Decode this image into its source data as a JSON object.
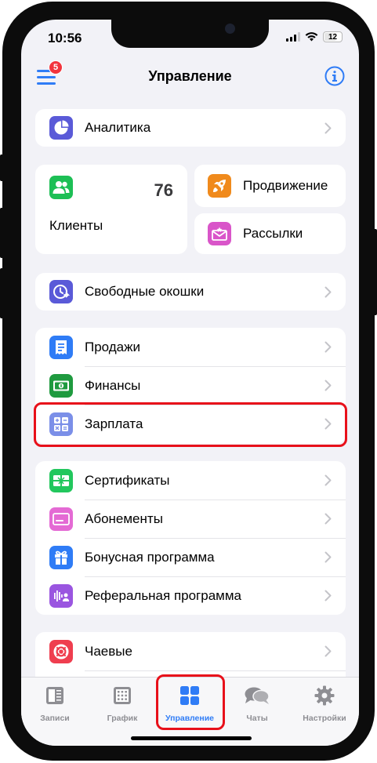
{
  "status": {
    "time": "10:56",
    "battery": "12"
  },
  "header": {
    "title": "Управление",
    "badge_count": "5"
  },
  "analytics": {
    "label": "Аналитика"
  },
  "clients": {
    "label": "Клиенты",
    "count": "76"
  },
  "promotion": {
    "label": "Продвижение"
  },
  "mailings": {
    "label": "Рассылки"
  },
  "free_slots": {
    "label": "Свободные окошки"
  },
  "group_finance": {
    "items": [
      {
        "label": "Продажи"
      },
      {
        "label": "Финансы"
      },
      {
        "label": "Зарплата"
      }
    ]
  },
  "group_programs": {
    "items": [
      {
        "label": "Сертификаты"
      },
      {
        "label": "Абонементы"
      },
      {
        "label": "Бонусная программа"
      },
      {
        "label": "Реферальная программа"
      }
    ]
  },
  "tips": {
    "label": "Чаевые"
  },
  "tabbar": {
    "tabs": [
      {
        "label": "Записи",
        "icon": "records-icon"
      },
      {
        "label": "График",
        "icon": "schedule-icon"
      },
      {
        "label": "Управление",
        "icon": "management-icon",
        "active": true
      },
      {
        "label": "Чаты",
        "icon": "chats-icon"
      },
      {
        "label": "Настройки",
        "icon": "gear-icon"
      }
    ]
  },
  "colors": {
    "accent": "#2f7cf6",
    "highlight": "#e8101a",
    "badge": "#f2343d"
  }
}
